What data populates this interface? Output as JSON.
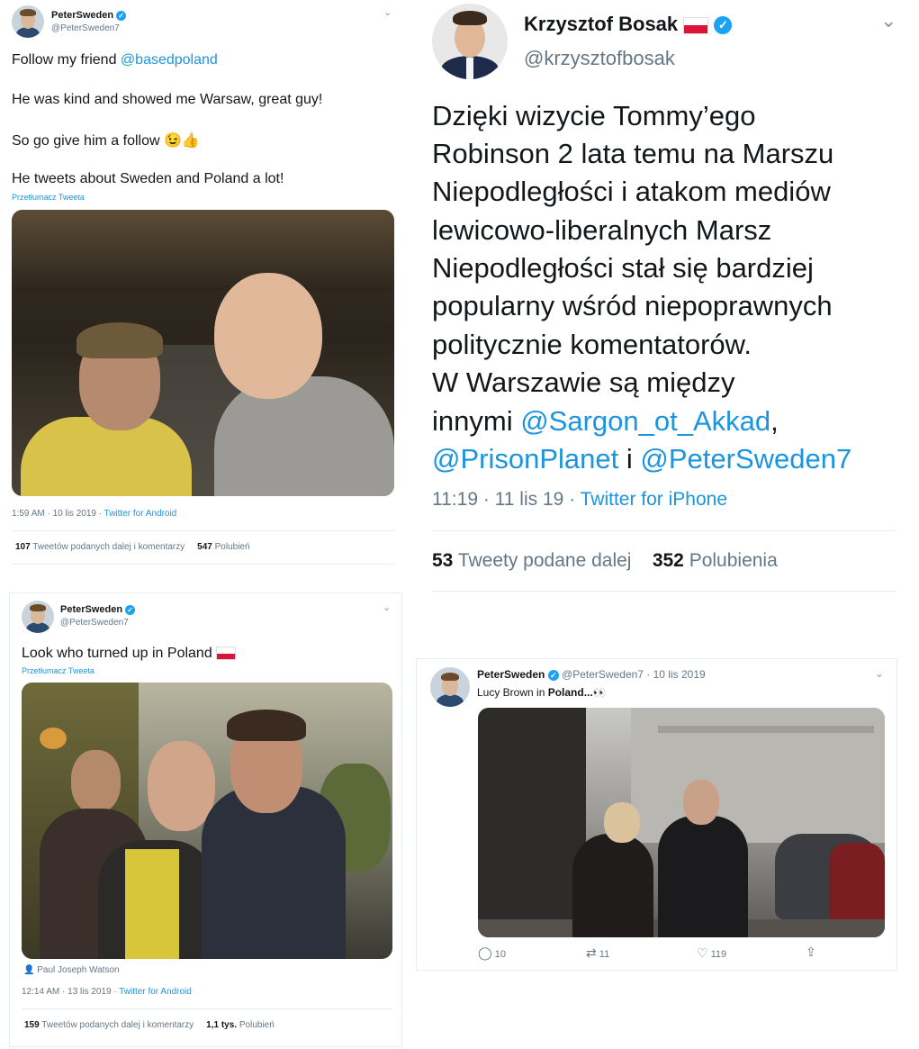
{
  "tweet1": {
    "name": "PeterSweden",
    "handle": "@PeterSweden7",
    "lines": [
      "Follow my friend ",
      "@basedpoland",
      "He was kind and showed me Warsaw, great guy!",
      "So go give him a follow 😉👍",
      "He tweets about Sweden and Poland a lot!"
    ],
    "translate": "Przetłumacz Tweeta",
    "time": "1:59 AM · 10 lis 2019 · ",
    "source": "Twitter for Android",
    "retweets_count": "107",
    "retweets_label": " Tweetów podanych dalej i komentarzy",
    "likes_count": "547",
    "likes_label": " Polubień"
  },
  "tweet2": {
    "name": "Krzysztof Bosak",
    "handle": "@krzysztofbosak",
    "lines": [
      "Dzięki wizycie Tommy’ego",
      "Robinson 2 lata temu na Marszu",
      "Niepodległości i atakom mediów",
      "lewicowo-liberalnych Marsz",
      "Niepodległości stał się bardziej",
      "popularny wśród niepoprawnych",
      "politycznie komentatorów.",
      "W Warszawie są między"
    ],
    "line9_a": "innymi ",
    "mention1": "@Sargon_ot_Akkad",
    "line9_b": ",",
    "mention2": "@PrisonPlanet",
    "line10_b": " i ",
    "mention3": "@PeterSweden7",
    "time": "11:19 · 11 lis 19 · ",
    "source": "Twitter for iPhone",
    "retweets_count": "53",
    "retweets_label": " Tweety podane dalej",
    "likes_count": "352",
    "likes_label": " Polubienia"
  },
  "tweet3": {
    "name": "PeterSweden",
    "handle": "@PeterSweden7",
    "text": "Look who turned up in Poland",
    "translate": "Przetłumacz Tweeta",
    "tagged": "Paul Joseph Watson",
    "time": "12:14 AM · 13 lis 2019 · ",
    "source": "Twitter for Android",
    "retweets_count": "159",
    "retweets_label": " Tweetów podanych dalej i komentarzy",
    "likes_count": "1,1 tys.",
    "likes_label": " Polubień"
  },
  "tweet4": {
    "name": "PeterSweden",
    "handle_date": "@PeterSweden7 · 10 lis 2019",
    "text_a": "Lucy Brown in ",
    "text_b": "Poland...",
    "text_c": "👀",
    "replies": "10",
    "retweets": "11",
    "likes": "119"
  },
  "colors": {
    "link": "#1b95e0",
    "verified": "#1da1f2",
    "flag_red": "#dc143c"
  },
  "icons": [
    "verified-badge-icon",
    "chevron-down-icon",
    "poland-flag-icon",
    "person-tag-icon",
    "reply-icon",
    "retweet-icon",
    "like-icon",
    "share-icon"
  ]
}
